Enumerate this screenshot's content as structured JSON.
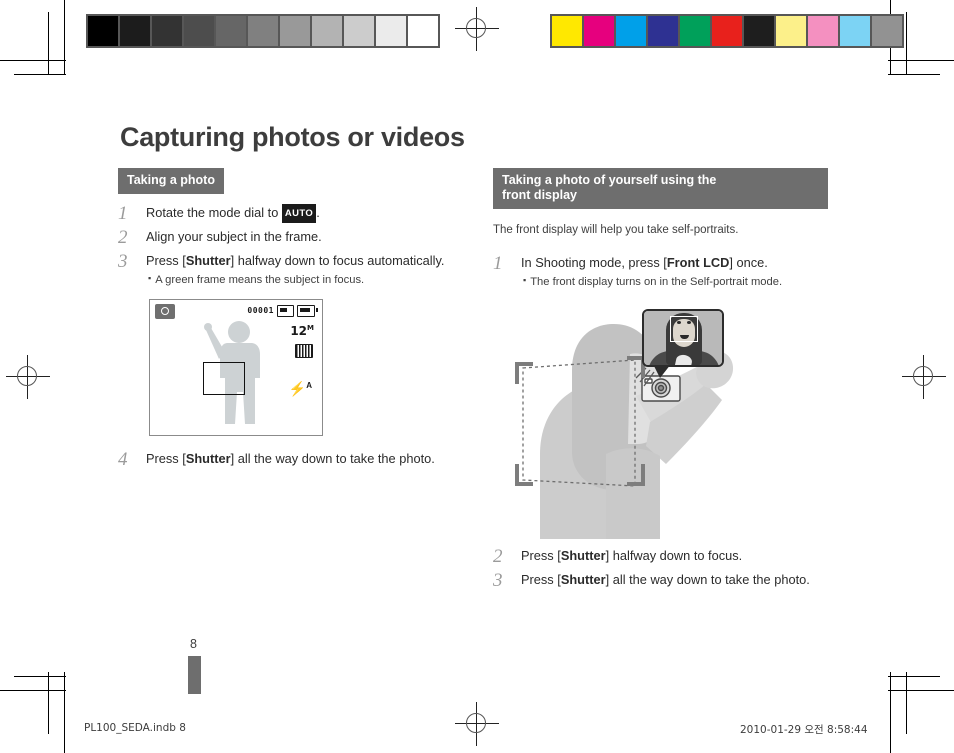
{
  "document": {
    "page_title": "Capturing photos or videos",
    "page_number": "8",
    "footer_left": "PL100_SEDA.indb   8",
    "footer_right": "2010-01-29   오전 8:58:44"
  },
  "left_column": {
    "section_heading": "Taking a photo",
    "steps": [
      {
        "num": "1",
        "text_before": "Rotate the mode dial to ",
        "badge": "AUTO",
        "text_after": "."
      },
      {
        "num": "2",
        "text_before": "Align your subject in the frame.",
        "badge": "",
        "text_after": ""
      },
      {
        "num": "3",
        "text_before": "Press [",
        "bold": "Shutter",
        "text_after": "] halfway down to focus automatically.",
        "bullet": "A green frame means the subject in focus."
      },
      {
        "num": "4",
        "text_before": "Press [",
        "bold": "Shutter",
        "text_after": "] all the way down to take the photo."
      }
    ],
    "lcd": {
      "mode_icon": "camera-mode-icon",
      "shots_remaining": "00001",
      "memory_card_icon": "memory-card-icon",
      "battery_icon": "battery-full-icon",
      "resolution": "12",
      "resolution_unit": "M",
      "quality_icon": "image-quality-icon",
      "flash_label": "⚡",
      "flash_mode": "A",
      "focus_frame": "af-focus-frame"
    }
  },
  "right_column": {
    "section_heading_line1": "Taking a photo of yourself using the",
    "section_heading_line2": "front display",
    "intro": "The front display will help you take self-portraits.",
    "steps": [
      {
        "num": "1",
        "text_before": "In Shooting mode, press [",
        "bold": "Front LCD",
        "text_after": "] once.",
        "bullet": "The front display turns on in the Self-portrait mode."
      },
      {
        "num": "2",
        "text_before": "Press [",
        "bold": "Shutter",
        "text_after": "] halfway down to focus."
      },
      {
        "num": "3",
        "text_before": "Press [",
        "bold": "Shutter",
        "text_after": "] all the way down to take the photo."
      }
    ],
    "illustration": {
      "callout": "front-display-preview-callout",
      "subject": "self-portrait-subject-illustration",
      "frame": "composition-frame-brackets"
    }
  },
  "print_marks": {
    "grayscale_swatches": [
      "#000000",
      "#1c1c1c",
      "#333333",
      "#4d4d4d",
      "#666666",
      "#808080",
      "#999999",
      "#b3b3b3",
      "#cccccc",
      "#ebebeb",
      "#ffffff"
    ],
    "color_swatches": [
      "#ffe800",
      "#e6007e",
      "#00a0e9",
      "#2e3192",
      "#00a05a",
      "#e8211c",
      "#1e1e1e",
      "#fcf08a",
      "#f490c0",
      "#7cd3f4",
      "#929292"
    ],
    "registration_mark": "registration-crosshair",
    "crop_mark": "crop-trim-mark"
  }
}
